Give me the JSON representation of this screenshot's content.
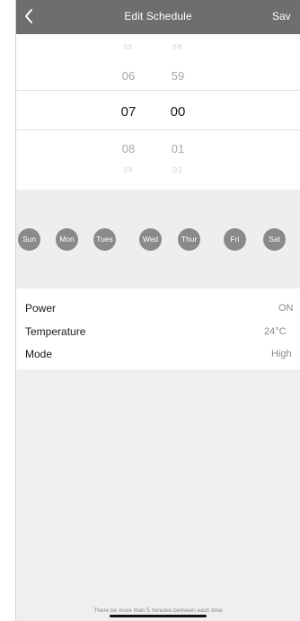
{
  "nav": {
    "title": "Edit Schedule",
    "save_label": "Sav"
  },
  "time_picker": {
    "hours": {
      "far_above": "05",
      "above": "06",
      "selected": "07",
      "below": "08",
      "far_below": "09"
    },
    "minutes": {
      "far_above": "58",
      "above": "59",
      "selected": "00",
      "below": "01",
      "far_below": "02"
    }
  },
  "days": [
    "Sun",
    "Mon",
    "Tues",
    "Wed",
    "Thur",
    "Fri",
    "Sat"
  ],
  "settings": {
    "power": {
      "label": "Power",
      "value": "ON"
    },
    "temperature": {
      "label": "Temperature",
      "value": "24°C"
    },
    "mode": {
      "label": "Mode",
      "value": "High"
    }
  },
  "footer_note": "There be more than 5 minutes between each time",
  "colors": {
    "nav_bar": "#6e6e6e",
    "day_chip": "#8a8a8a",
    "section_background": "#eeeeee"
  }
}
